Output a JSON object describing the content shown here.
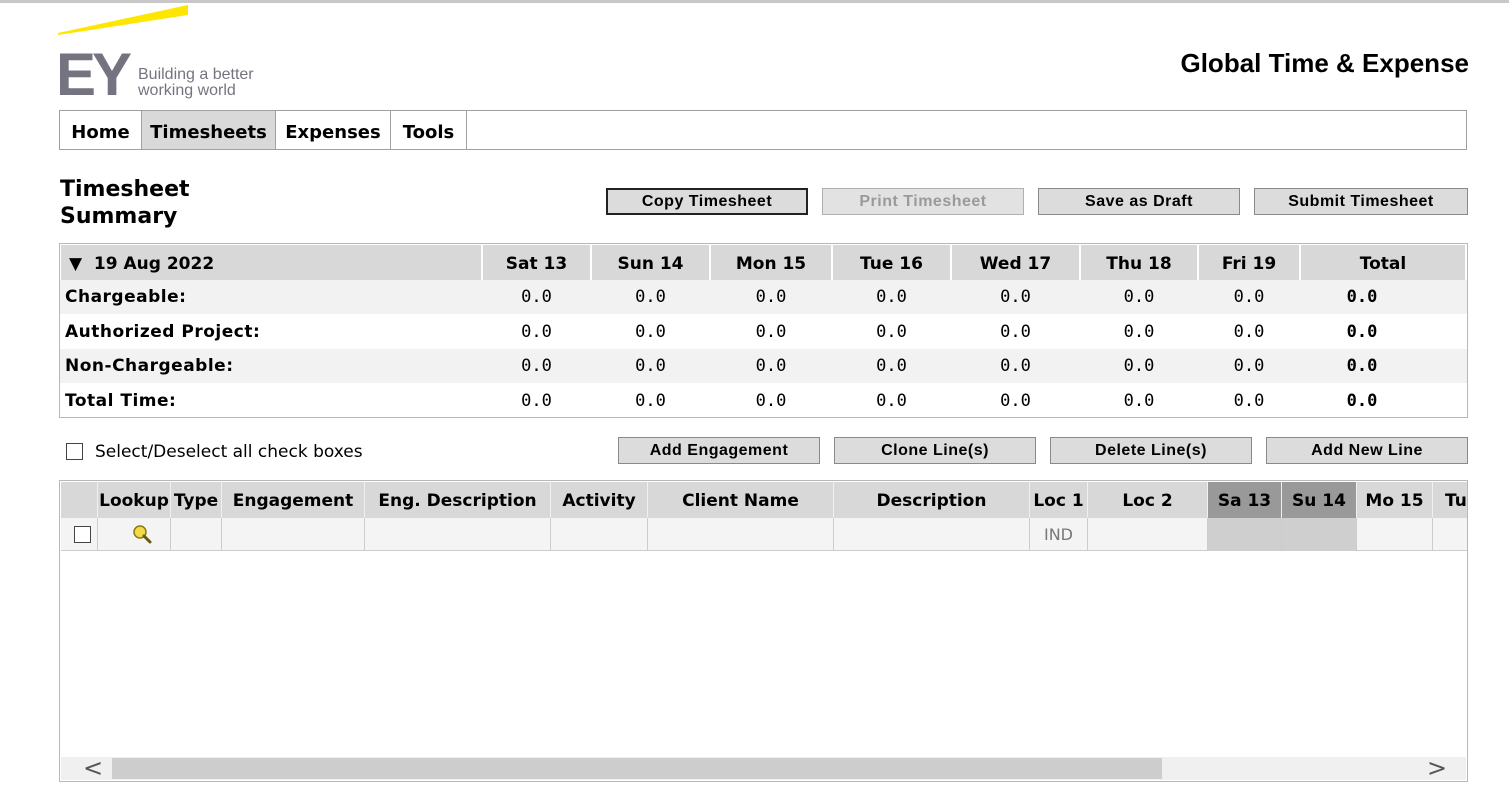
{
  "header": {
    "logo_text": "EY",
    "tagline_line1": "Building a better",
    "tagline_line2": "working world",
    "app_title": "Global Time & Expense",
    "brand_yellow": "#ffe600",
    "brand_gray": "#747480"
  },
  "nav": {
    "tabs": [
      {
        "label": "Home"
      },
      {
        "label": "Timesheets",
        "active": true
      },
      {
        "label": "Expenses"
      },
      {
        "label": "Tools"
      }
    ]
  },
  "summary": {
    "title_line1": "Timesheet",
    "title_line2": "Summary",
    "buttons": {
      "copy": "Copy Timesheet",
      "print": "Print Timesheet",
      "save_draft": "Save as Draft",
      "submit": "Submit Timesheet"
    },
    "period": "19 Aug 2022",
    "period_toggle": "▼",
    "days": [
      "Sat 13",
      "Sun 14",
      "Mon 15",
      "Tue 16",
      "Wed 17",
      "Thu 18",
      "Fri 19"
    ],
    "total_header": "Total",
    "rows": [
      {
        "label": "Chargeable:",
        "values": [
          "0.0",
          "0.0",
          "0.0",
          "0.0",
          "0.0",
          "0.0",
          "0.0"
        ],
        "total": "0.0"
      },
      {
        "label": "Authorized Project:",
        "values": [
          "0.0",
          "0.0",
          "0.0",
          "0.0",
          "0.0",
          "0.0",
          "0.0"
        ],
        "total": "0.0"
      },
      {
        "label": "Non-Chargeable:",
        "values": [
          "0.0",
          "0.0",
          "0.0",
          "0.0",
          "0.0",
          "0.0",
          "0.0"
        ],
        "total": "0.0"
      },
      {
        "label": "Total Time:",
        "values": [
          "0.0",
          "0.0",
          "0.0",
          "0.0",
          "0.0",
          "0.0",
          "0.0"
        ],
        "total": "0.0"
      }
    ]
  },
  "actions": {
    "select_all_label": "Select/Deselect all check boxes",
    "add_engagement": "Add Engagement",
    "clone_lines": "Clone Line(s)",
    "delete_lines": "Delete Line(s)",
    "add_new_line": "Add New Line"
  },
  "grid": {
    "columns": [
      "Lookup",
      "Type",
      "Engagement",
      "Eng. Description",
      "Activity",
      "Client Name",
      "Description",
      "Loc 1",
      "Loc 2",
      "Sa 13",
      "Su 14",
      "Mo 15",
      "Tu"
    ],
    "first_row": {
      "loc1": "IND"
    },
    "lookup_icon": "magnifier-icon"
  },
  "scrollbar": {
    "left_arrow": "<",
    "right_arrow": ">"
  }
}
